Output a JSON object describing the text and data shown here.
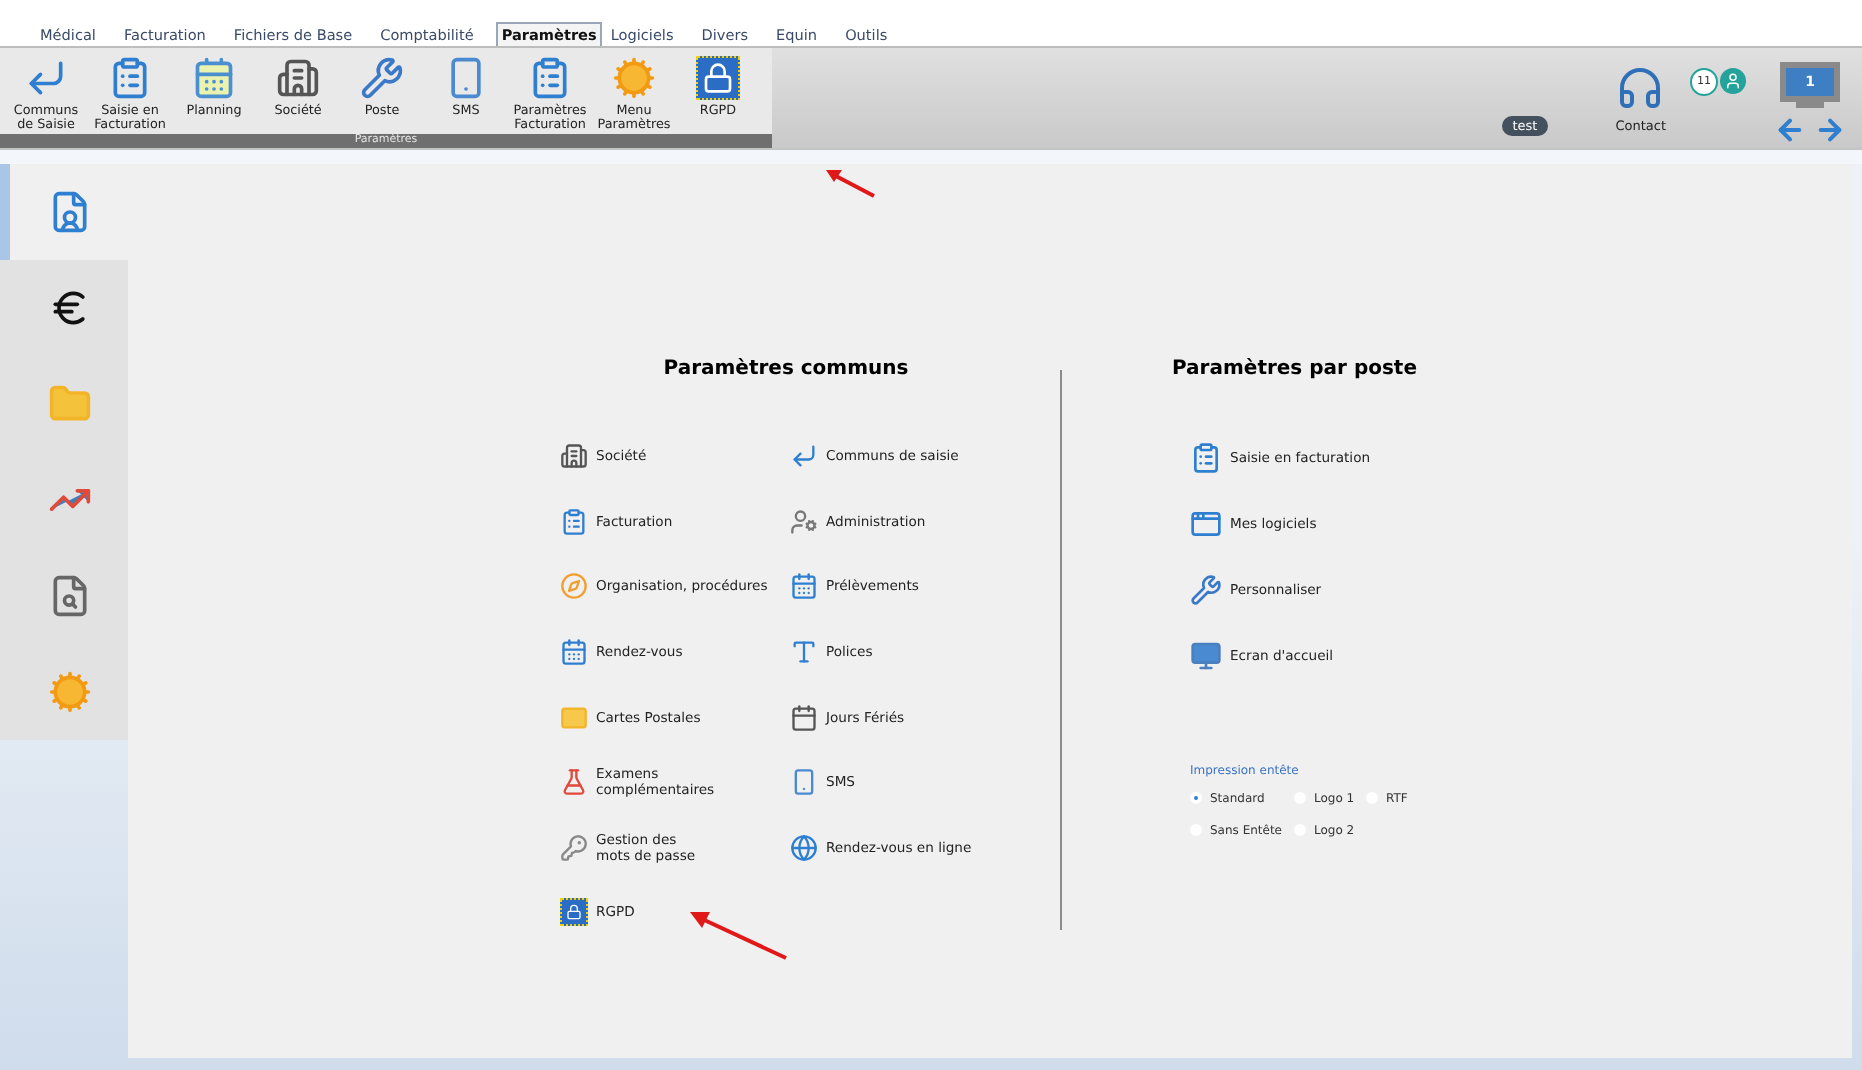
{
  "menu": [
    {
      "label": "Médical",
      "selected": false
    },
    {
      "label": "Facturation",
      "selected": false
    },
    {
      "label": "Fichiers de Base",
      "selected": false
    },
    {
      "label": "Comptabilité",
      "selected": false
    },
    {
      "label": "Paramètres",
      "selected": true
    },
    {
      "label": "Logiciels",
      "selected": false
    },
    {
      "label": "Divers",
      "selected": false
    },
    {
      "label": "Equin",
      "selected": false
    },
    {
      "label": "Outils",
      "selected": false
    }
  ],
  "toolbar": {
    "buttons": [
      "Communs\nde Saisie",
      "Saisie en\nFacturation",
      "Planning",
      "Société",
      "Poste",
      "SMS",
      "Paramètres\nFacturation",
      "Menu\nParamètres",
      "RGPD"
    ],
    "group_label": "Paramètres"
  },
  "status": {
    "user_tag": "test",
    "contact": "Contact",
    "badge_count": "11",
    "screen_number": "1"
  },
  "sidebar": {
    "items": [
      {
        "selected": true
      },
      {
        "selected": false
      },
      {
        "selected": false
      },
      {
        "selected": false
      },
      {
        "selected": false
      },
      {
        "selected": false
      }
    ]
  },
  "common": {
    "title": "Paramètres communs",
    "items": [
      "Société",
      "Communs de saisie",
      "Facturation",
      "Administration",
      "Organisation, procédures",
      "Prélèvements",
      "Rendez-vous",
      "Polices",
      "Cartes Postales",
      "Jours Fériés",
      "Examens\ncomplémentaires",
      "SMS",
      "Gestion des\nmots de passe",
      "Rendez-vous en ligne",
      "RGPD"
    ]
  },
  "per_station": {
    "title": "Paramètres par poste",
    "items": [
      "Saisie en facturation",
      "Mes logiciels",
      "Personnaliser",
      "Ecran d'accueil"
    ],
    "print_header": {
      "label": "Impression entête",
      "options": [
        {
          "label": "Standard",
          "selected": true
        },
        {
          "label": "Logo 1",
          "selected": false
        },
        {
          "label": "RTF",
          "selected": false
        },
        {
          "label": "Sans Entête",
          "selected": false
        },
        {
          "label": "Logo 2",
          "selected": false
        }
      ]
    }
  }
}
